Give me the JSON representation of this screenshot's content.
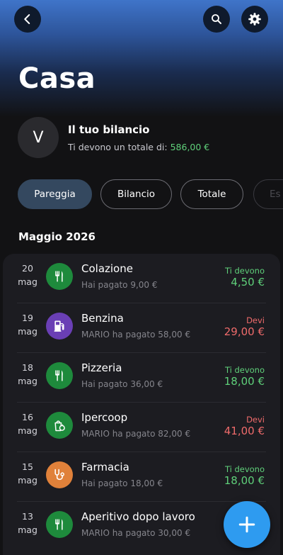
{
  "header": {
    "title": "Casa"
  },
  "balance": {
    "avatar_letter": "V",
    "title": "Il tuo bilancio",
    "subtitle": "Ti devono un totale di:",
    "amount": "586,00 €",
    "amount_color": "#5fd07a"
  },
  "chips": [
    {
      "label": "Pareggia",
      "active": true
    },
    {
      "label": "Bilancio",
      "active": false
    },
    {
      "label": "Totale",
      "active": false
    },
    {
      "label": "Es",
      "active": false
    }
  ],
  "month": "Maggio 2026",
  "expenses": [
    {
      "day": "20",
      "month": "mag",
      "icon": "cutlery-icon",
      "icon_color": "#1e8a3c",
      "name": "Colazione",
      "paid_text": "Hai pagato 9,00 €",
      "status": "Ti devono",
      "amount": "4,50 €",
      "type": "pos"
    },
    {
      "day": "19",
      "month": "mag",
      "icon": "fuel-pump-icon",
      "icon_color": "#6a3fb5",
      "name": "Benzina",
      "paid_text": "MARIO ha pagato 58,00 €",
      "status": "Devi",
      "amount": "29,00 €",
      "type": "neg"
    },
    {
      "day": "18",
      "month": "mag",
      "icon": "cutlery-icon",
      "icon_color": "#1e8a3c",
      "name": "Pizzeria",
      "paid_text": "Hai pagato 36,00 €",
      "status": "Ti devono",
      "amount": "18,00 €",
      "type": "pos"
    },
    {
      "day": "16",
      "month": "mag",
      "icon": "grocery-bag-icon",
      "icon_color": "#1e8a3c",
      "name": "Ipercoop",
      "paid_text": "MARIO ha pagato 82,00 €",
      "status": "Devi",
      "amount": "41,00 €",
      "type": "neg"
    },
    {
      "day": "15",
      "month": "mag",
      "icon": "stethoscope-icon",
      "icon_color": "#e0813a",
      "name": "Farmacia",
      "paid_text": "Hai pagato 18,00 €",
      "status": "Ti devono",
      "amount": "18,00 €",
      "type": "pos"
    },
    {
      "day": "13",
      "month": "mag",
      "icon": "cutlery-icon",
      "icon_color": "#1e8a3c",
      "name": "Aperitivo dopo lavoro",
      "paid_text": "MARIO ha pagato 30,00 €",
      "status": "",
      "amount": "",
      "type": "neg"
    }
  ],
  "colors": {
    "positive": "#5fd07a",
    "negative": "#ef6b6b",
    "fab": "#2e9bf0",
    "active_chip": "#34485f"
  }
}
